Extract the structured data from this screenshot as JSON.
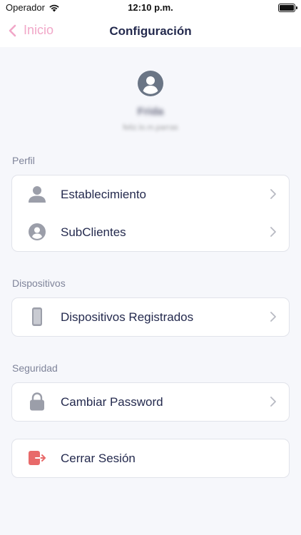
{
  "status_bar": {
    "carrier": "Operador",
    "time": "12:10 p.m.",
    "battery_level": 1.0
  },
  "nav": {
    "back_label": "Inicio",
    "title": "Configuración"
  },
  "profile": {
    "name": "Frida",
    "subtitle": "feliz.lo.m.parras"
  },
  "sections": {
    "perfil": {
      "label": "Perfil",
      "items": [
        {
          "label": "Establecimiento",
          "icon": "person-icon"
        },
        {
          "label": "SubClientes",
          "icon": "person-circle-icon"
        }
      ]
    },
    "dispositivos": {
      "label": "Dispositivos",
      "items": [
        {
          "label": "Dispositivos Registrados",
          "icon": "phone-icon"
        }
      ]
    },
    "seguridad": {
      "label": "Seguridad",
      "items": [
        {
          "label": "Cambiar Password",
          "icon": "lock-icon"
        }
      ]
    },
    "logout": {
      "label": "Cerrar Sesión",
      "icon": "logout-icon"
    }
  },
  "colors": {
    "accent": "#f1a7c8",
    "title": "#242a4e",
    "icon_gray": "#9b9ea9",
    "logout_red": "#e86a6a",
    "background": "#f6f7fb"
  }
}
